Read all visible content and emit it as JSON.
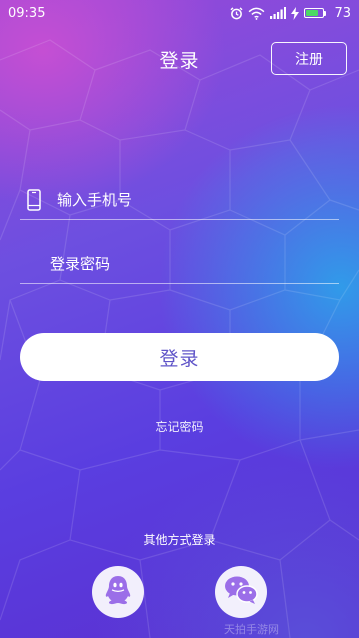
{
  "status_bar": {
    "time": "09:35",
    "battery_level": "73",
    "battery_fraction": 0.73,
    "icons": [
      "alarm-icon",
      "wifi-icon",
      "signal-icon",
      "charging-icon",
      "battery-icon"
    ]
  },
  "header": {
    "title": "登录",
    "register_label": "注册"
  },
  "form": {
    "phone_placeholder": "输入手机号",
    "password_placeholder": "登录密码",
    "login_label": "登录",
    "forgot_label": "忘记密码"
  },
  "other_login": {
    "label": "其他方式登录",
    "options": [
      "qq-icon",
      "wechat-icon"
    ]
  },
  "watermark": "天拍手游网",
  "colors": {
    "background_top": "#9a48d8",
    "background_bottom": "#5b2fd0",
    "accent_text": "#5f54c8",
    "battery_fill": "#4cd964"
  }
}
